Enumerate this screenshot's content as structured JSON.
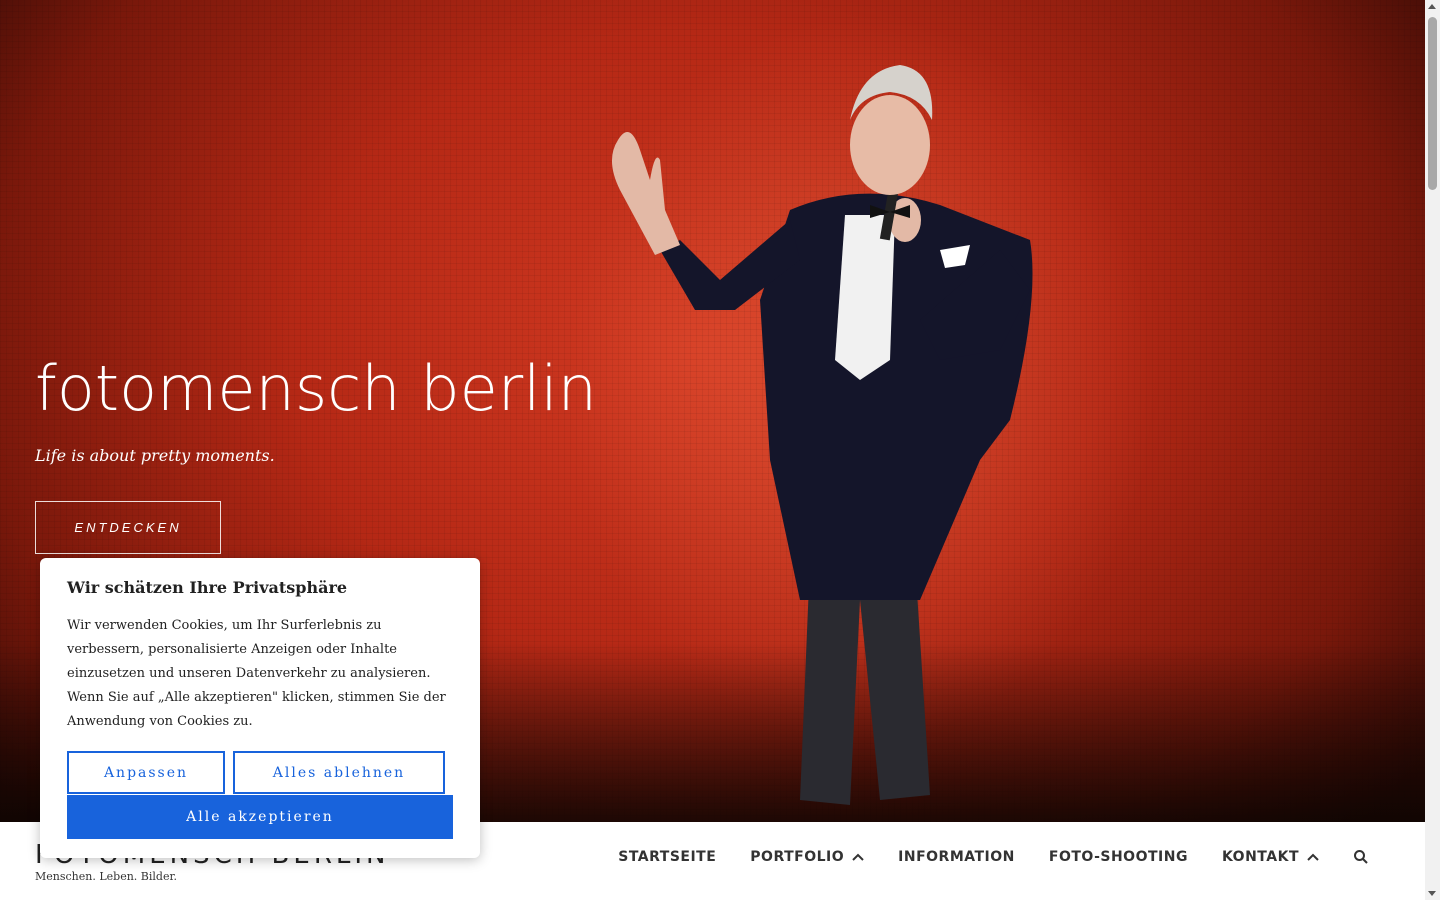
{
  "hero": {
    "title": "fotomensch berlin",
    "tagline": "Life is about pretty moments.",
    "button_label": "ENTDECKEN"
  },
  "header": {
    "site_title": "FOTOMENSCH BERLIN",
    "site_description": "Menschen. Leben. Bilder.",
    "nav": [
      {
        "label": "STARTSEITE"
      },
      {
        "label": "PORTFOLIO",
        "icon": "chevron-up-icon"
      },
      {
        "label": "INFORMATION"
      },
      {
        "label": "FOTO-SHOOTING"
      },
      {
        "label": "KONTAKT",
        "icon": "chevron-up-icon"
      }
    ],
    "search_icon": "search-icon"
  },
  "cookie_banner": {
    "title": "Wir schätzen Ihre Privatsphäre",
    "text": "Wir verwenden Cookies, um Ihr Surferlebnis zu verbessern, personalisierte Anzeigen oder Inhalte einzusetzen und unseren Datenverkehr zu analysieren. Wenn Sie auf „Alle akzeptieren\" klicken, stimmen Sie der Anwendung von Cookies zu.",
    "customize_label": "Anpassen",
    "reject_label": "Alles ablehnen",
    "accept_label": "Alle akzeptieren"
  },
  "colors": {
    "accent": "#1863dc",
    "hero_red": "#c2301b"
  }
}
